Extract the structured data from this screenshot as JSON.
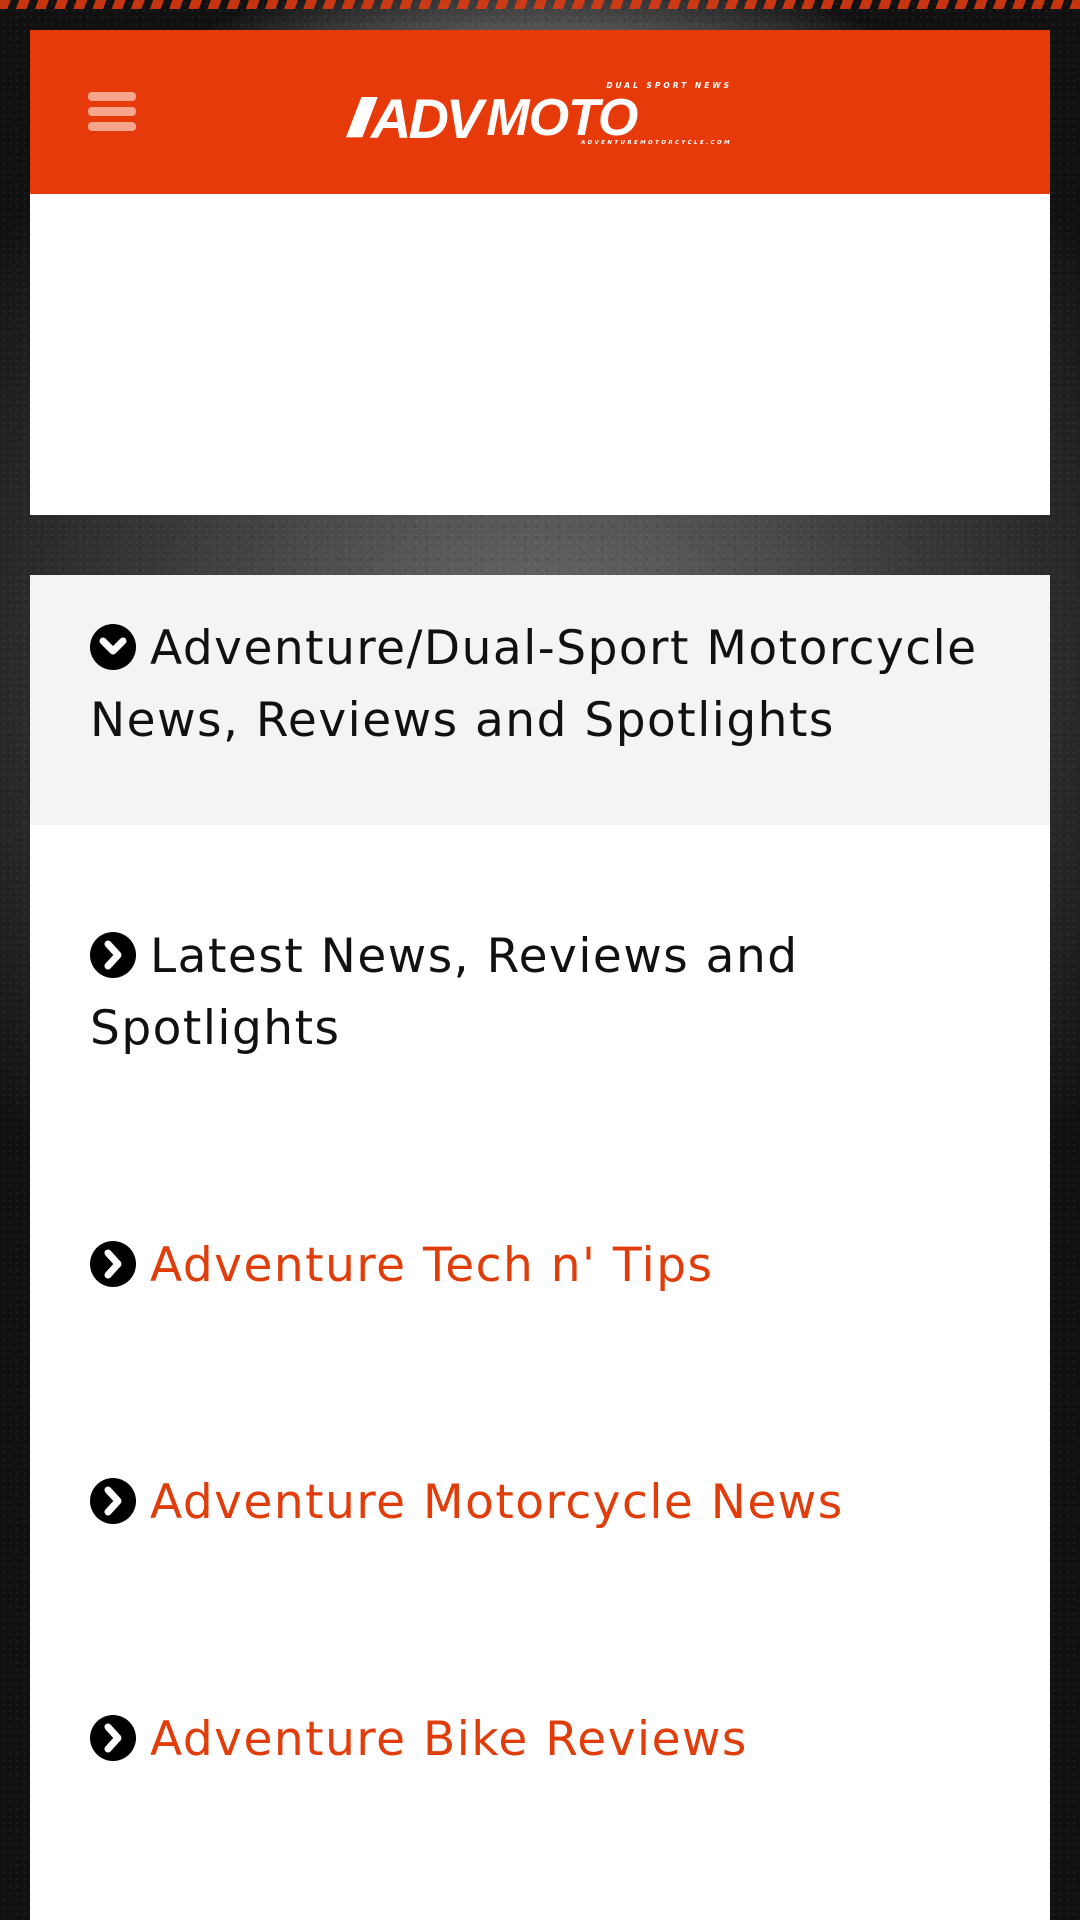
{
  "header": {
    "logo": {
      "slashes": "///",
      "adv": "ADV",
      "moto": "MOTO",
      "tagline_top": "DUAL SPORT NEWS",
      "tagline_bottom": "ADVENTUREMOTORCYCLE.COM"
    },
    "colors": {
      "brand": "#e63a0a",
      "accent_text": "#e03d0b"
    },
    "menu_icon": "hamburger-icon"
  },
  "section": {
    "title": "Adventure/Dual-Sport Motorcycle News, Reviews and Spotlights",
    "icon": "chevron-circle-down-icon"
  },
  "items": [
    {
      "label": "Latest News, Reviews and Spotlights",
      "icon": "chevron-circle-right-icon"
    },
    {
      "label": "Adventure Tech n' Tips",
      "icon": "chevron-circle-right-icon"
    },
    {
      "label": "Adventure Motorcycle News",
      "icon": "chevron-circle-right-icon"
    },
    {
      "label": "Adventure Bike Reviews",
      "icon": "chevron-circle-right-icon"
    }
  ]
}
